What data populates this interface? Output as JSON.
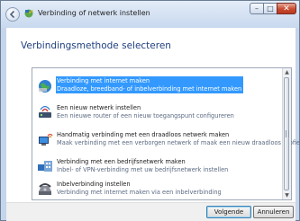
{
  "window": {
    "title": "Verbinding of netwerk instellen",
    "caption_buttons": {
      "minimize": "–",
      "maximize": "□",
      "close": "✕"
    }
  },
  "main": {
    "heading": "Verbindingsmethode selecteren",
    "options": [
      {
        "title": "Verbinding met internet maken",
        "description": "Draadloze, breedband- of inbelverbinding met internet maken",
        "icon": "internet-globe-icon",
        "selected": true
      },
      {
        "title": "Een nieuw netwerk instellen",
        "description": "Een nieuwe router of een nieuw toegangspunt configureren",
        "icon": "router-icon",
        "selected": false
      },
      {
        "title": "Handmatig verbinding met een draadloos netwerk maken",
        "description": "Maak verbinding met een verborgen netwerk of maak een nieuw draadloos profiel.",
        "icon": "wireless-computer-icon",
        "selected": false
      },
      {
        "title": "Verbinding met een bedrijfsnetwerk maken",
        "description": "Inbel- of VPN-verbinding met uw bedrijfsnetwerk instellen",
        "icon": "workplace-network-icon",
        "selected": false
      },
      {
        "title": "Inbelverbinding instellen",
        "description": "Verbinding met internet maken via een inbelverbinding",
        "icon": "dialup-phone-icon",
        "selected": false
      }
    ]
  },
  "footer": {
    "next_label": "Volgende",
    "cancel_label": "Annuleren"
  },
  "colors": {
    "selection": "#3399ff",
    "heading": "#1f3f7f"
  }
}
